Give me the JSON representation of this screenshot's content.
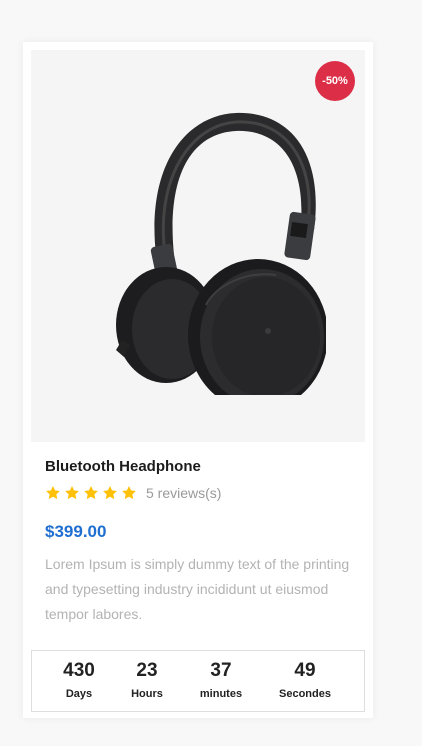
{
  "product": {
    "discount": "-50%",
    "title": "Bluetooth Headphone",
    "rating": 5,
    "rating_max": 5,
    "reviews": "5 reviews(s)",
    "price": "$399.00",
    "description": "Lorem Ipsum is simply dummy text of the printing and typesetting industry incididunt ut eiusmod tempor labores.",
    "image": "headphones-image"
  },
  "countdown": [
    {
      "value": "430",
      "label": "Days"
    },
    {
      "value": "23",
      "label": "Hours"
    },
    {
      "value": "37",
      "label": "minutes"
    },
    {
      "value": "49",
      "label": "Secondes"
    }
  ],
  "colors": {
    "accent_price": "#1f6fd1",
    "discount_badge": "#dc2f47",
    "star": "#ffc107"
  }
}
